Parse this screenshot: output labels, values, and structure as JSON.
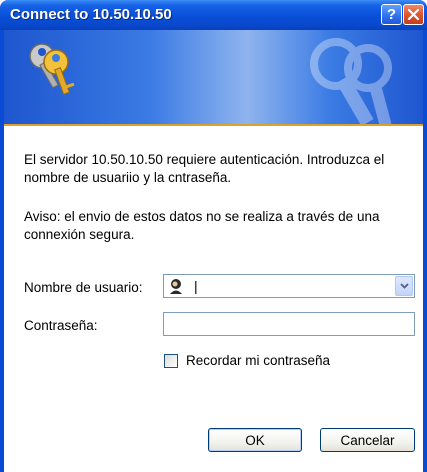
{
  "window": {
    "title": "Connect to 10.50.10.50",
    "help_glyph": "?",
    "help_icon": "help-question-icon",
    "close_icon": "close-x-icon"
  },
  "banner": {
    "icon": "keys-icon"
  },
  "message": {
    "line1": "El servidor 10.50.10.50 requiere autenticación.  Introduzca el nombre de usuariio y la cntraseña.",
    "line2": "Aviso: el envio de estos datos no se realiza a través de una connexión segura."
  },
  "form": {
    "username_label": "Nombre de usuario:",
    "username_value": "",
    "password_label": "Contraseña:",
    "password_value": "",
    "remember_label": "Recordar mi contraseña",
    "remember_checked": false
  },
  "buttons": {
    "ok": "OK",
    "cancel": "Cancelar"
  },
  "colors": {
    "titlebar": "#0a4fd8",
    "banner_accent": "#e0a12a",
    "close_button": "#e0552e"
  }
}
